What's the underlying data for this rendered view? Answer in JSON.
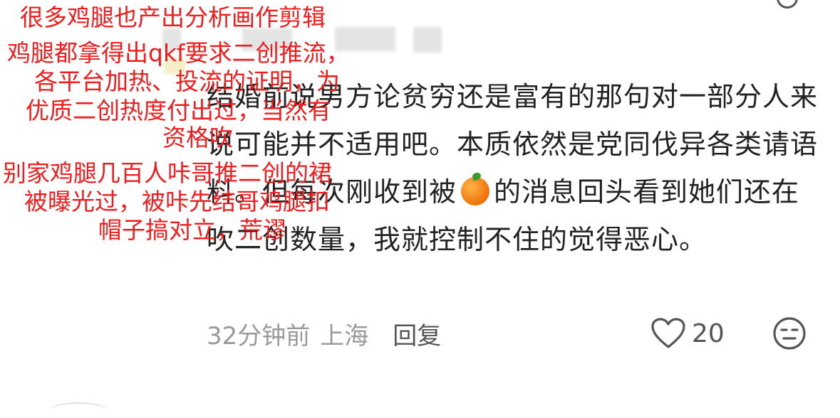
{
  "comment": {
    "text_before_emoji": "结婚前说男方论贫穷还是富有的那句对一部分人来说可能并不适用吧。本质依然是党同伐异各类请语料。但每次刚收到被",
    "emoji": "orange-emoji",
    "text_after_emoji": "的消息回头看到她们还在吹二创数量，我就控制不住的觉得恶心。"
  },
  "meta": {
    "time": "32分钟前",
    "location": "上海",
    "reply_label": "回复",
    "like_count": "20"
  },
  "overlay_text": {
    "line1": "很多鸡腿也产出分析画作剪辑",
    "line2": "鸡腿都拿得出qkf要求二创推流，",
    "line3": "各平台加热、投流的证明，为",
    "line4": "优质二创热度付出过，当然有",
    "line5": "资格吹",
    "line6": "别家鸡腿几百人咔哥推二创的裙",
    "line7": "被曝光过，被咔先结哥鸡腿扣",
    "line8": "帽子搞对立，荒谬"
  },
  "colors": {
    "overlay_red": "#ef1d1d",
    "body_text": "#222222",
    "meta_gray": "#9a9a9a"
  }
}
